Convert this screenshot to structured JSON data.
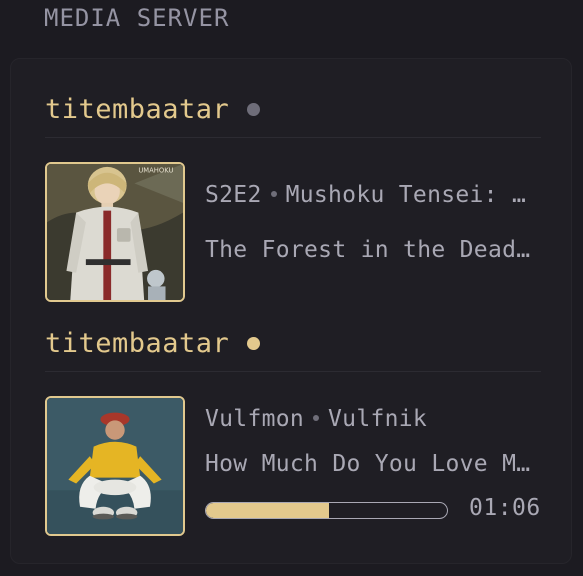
{
  "section": {
    "title": "MEDIA SERVER"
  },
  "sessions": [
    {
      "user": "titembaatar",
      "status": "idle",
      "status_color": "#6e6d79",
      "media": {
        "kind": "episode",
        "episode_code": "S2E2",
        "show_title": "Mushoku Tensei: …",
        "episode_title": "The Forest in the Dead…",
        "thumbnail": "anime-poster"
      }
    },
    {
      "user": "titembaatar",
      "status": "playing",
      "status_color": "#e3c98d",
      "media": {
        "kind": "track",
        "artist": "Vulfmon",
        "album": "Vulfnik",
        "track_title": "How Much Do You Love M…",
        "thumbnail": "album-cover",
        "progress_fraction": 0.51,
        "elapsed": "01:06"
      }
    }
  ],
  "colors": {
    "accent": "#e3c98d",
    "text": "#a9a8b4",
    "muted": "#9594a3",
    "background": "#1c1b21"
  }
}
